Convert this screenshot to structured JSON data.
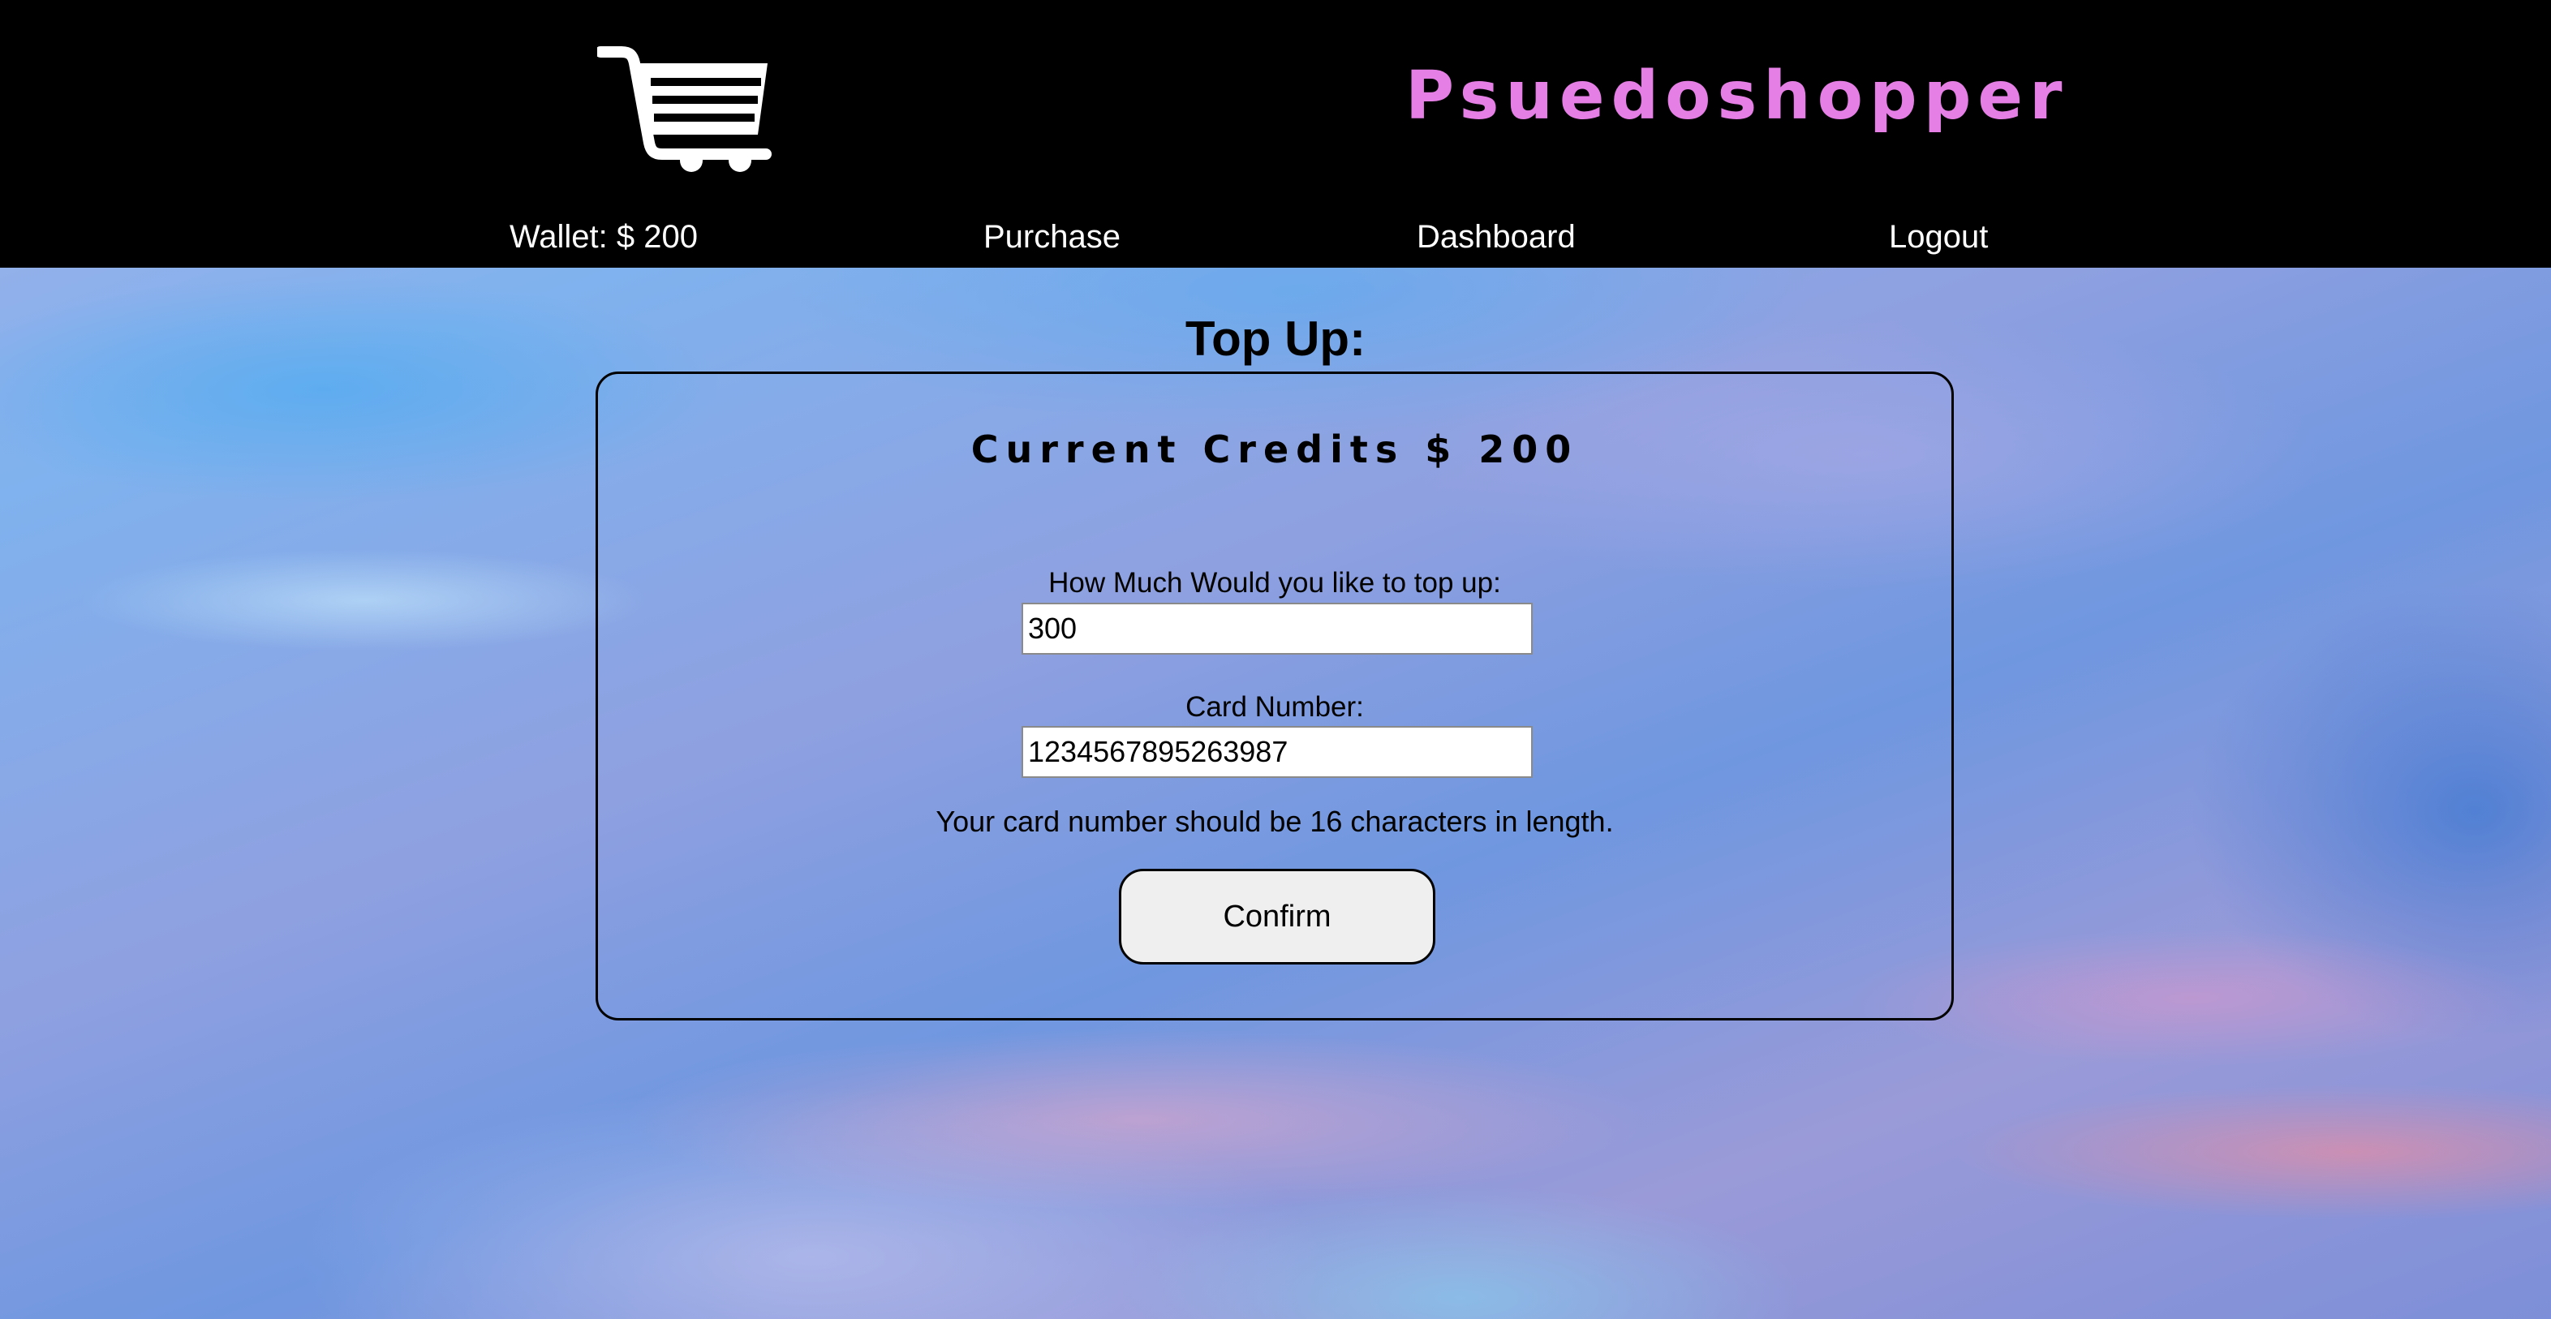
{
  "header": {
    "brand": "Psuedoshopper",
    "logo_icon": "shopping-cart-icon",
    "brand_color": "#e57fe6",
    "background": "#000000"
  },
  "nav": {
    "wallet": "Wallet: $ 200",
    "purchase": "Purchase",
    "dashboard": "Dashboard",
    "logout": "Logout"
  },
  "topup": {
    "title": "Top Up:",
    "current_credits": "Current Credits $ 200",
    "amount_label": "How Much Would you like to top up:",
    "amount_value": "300",
    "card_label": "Card Number:",
    "card_value": "1234567895263987",
    "hint": "Your card number should be 16 characters in length.",
    "confirm_label": "Confirm"
  }
}
